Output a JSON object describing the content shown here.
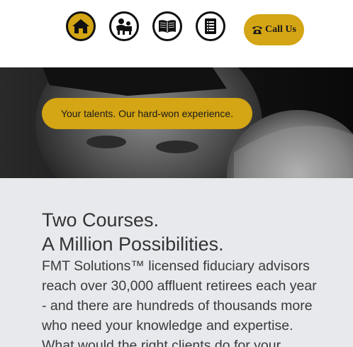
{
  "nav": {
    "items": [
      {
        "icon": "home-icon",
        "active": true
      },
      {
        "icon": "people-icon",
        "active": false
      },
      {
        "icon": "book-icon",
        "active": false
      },
      {
        "icon": "document-icon",
        "active": false
      }
    ],
    "call_label": "Call Us",
    "call_icon": "phone-icon"
  },
  "hero": {
    "tagline": "Your talents. Our hard-won experience."
  },
  "main": {
    "headline_line1": "Two Courses.",
    "headline_line2": "A Million Possibilities.",
    "body_lines": [
      "FMT Solutions™ licensed fiduciary advisors",
      "reach over 30,000 affluent retirees each year",
      "- and there are hundreds of thousands more",
      "who need your knowledge and expertise.",
      "What would the right clients do for your"
    ]
  },
  "colors": {
    "accent": "#d4a514",
    "content_bg": "#e8e9ed",
    "text": "#333333"
  }
}
